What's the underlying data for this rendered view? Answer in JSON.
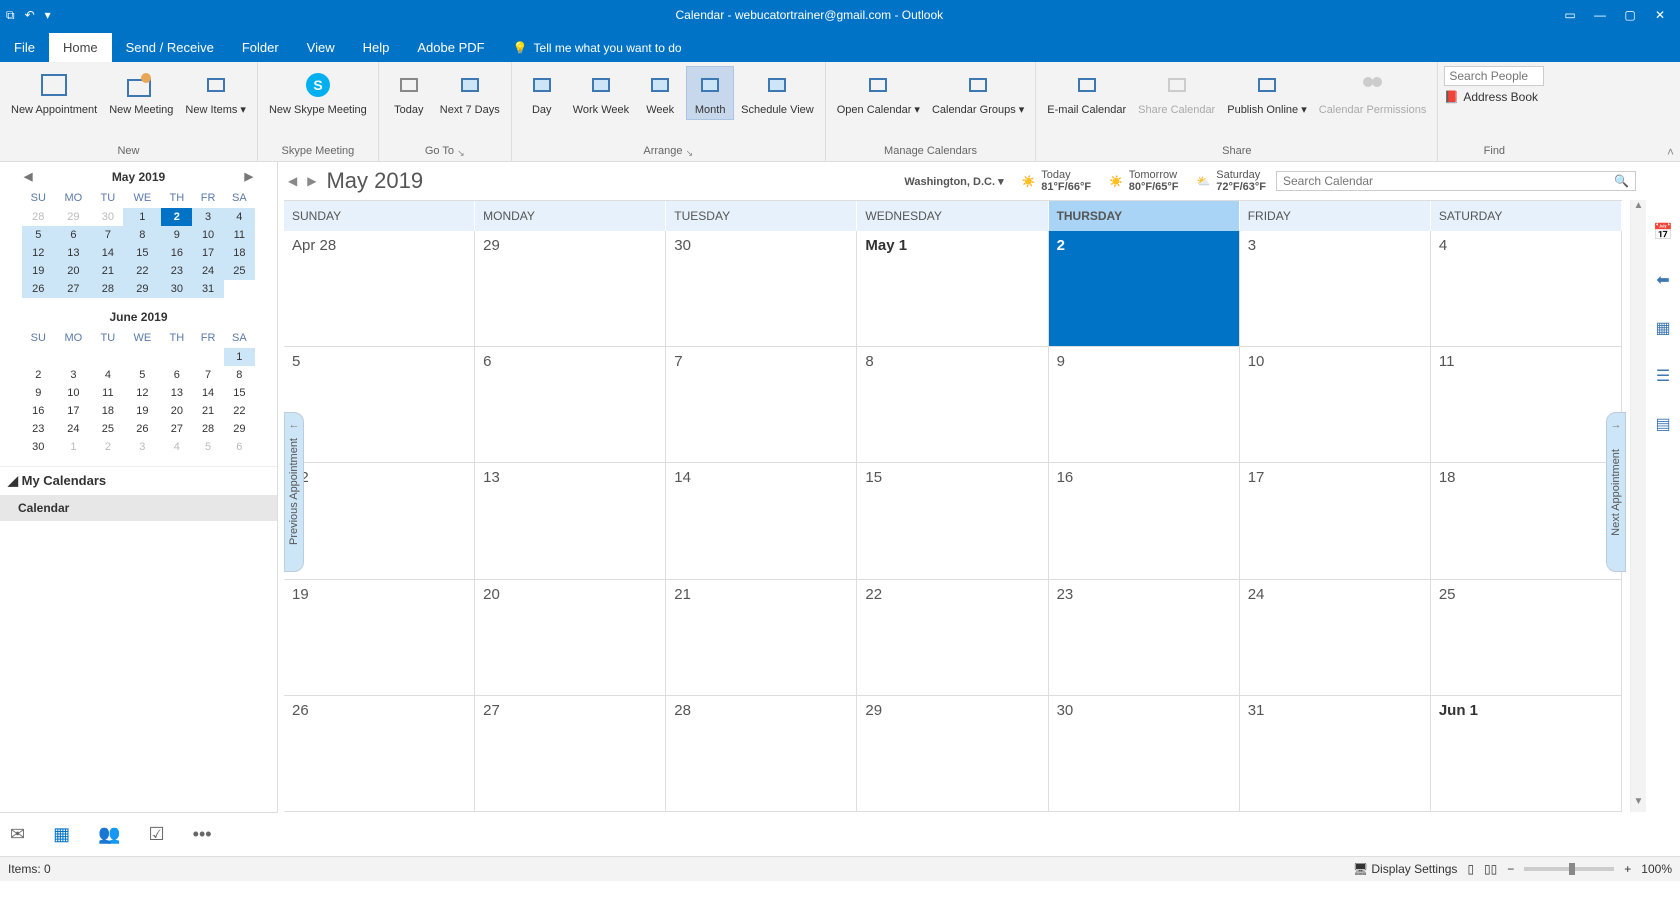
{
  "window": {
    "title": "Calendar - webucatortrainer@gmail.com - Outlook"
  },
  "tabs": [
    "File",
    "Home",
    "Send / Receive",
    "Folder",
    "View",
    "Help",
    "Adobe PDF"
  ],
  "active_tab": "Home",
  "tellme_placeholder": "Tell me what you want to do",
  "ribbon": {
    "new": {
      "appointment": "New Appointment",
      "meeting": "New Meeting",
      "items": "New Items ▾",
      "caption": "New"
    },
    "skype": {
      "meeting": "New Skype Meeting",
      "caption": "Skype Meeting"
    },
    "goto": {
      "today": "Today",
      "next7": "Next 7 Days",
      "caption": "Go To"
    },
    "arrange": {
      "day": "Day",
      "workweek": "Work Week",
      "week": "Week",
      "month": "Month",
      "schedule": "Schedule View",
      "caption": "Arrange"
    },
    "manage": {
      "open": "Open Calendar ▾",
      "groups": "Calendar Groups ▾",
      "caption": "Manage Calendars"
    },
    "share": {
      "email": "E-mail Calendar",
      "share": "Share Calendar",
      "publish": "Publish Online ▾",
      "perm": "Calendar Permissions",
      "caption": "Share"
    },
    "find": {
      "search_placeholder": "Search People",
      "address": "Address Book",
      "caption": "Find"
    }
  },
  "minical": [
    {
      "title": "May 2019",
      "weeks": [
        [
          {
            "d": "28",
            "o": true
          },
          {
            "d": "29",
            "o": true
          },
          {
            "d": "30",
            "o": true
          },
          {
            "d": "1",
            "hl": true
          },
          {
            "d": "2",
            "today": true
          },
          {
            "d": "3",
            "hl": true
          },
          {
            "d": "4",
            "hl": true
          }
        ],
        [
          {
            "d": "5",
            "hl": true
          },
          {
            "d": "6",
            "hl": true
          },
          {
            "d": "7",
            "hl": true
          },
          {
            "d": "8",
            "hl": true
          },
          {
            "d": "9",
            "hl": true
          },
          {
            "d": "10",
            "hl": true
          },
          {
            "d": "11",
            "hl": true
          }
        ],
        [
          {
            "d": "12",
            "hl": true
          },
          {
            "d": "13",
            "hl": true
          },
          {
            "d": "14",
            "hl": true
          },
          {
            "d": "15",
            "hl": true
          },
          {
            "d": "16",
            "hl": true
          },
          {
            "d": "17",
            "hl": true
          },
          {
            "d": "18",
            "hl": true
          }
        ],
        [
          {
            "d": "19",
            "hl": true
          },
          {
            "d": "20",
            "hl": true
          },
          {
            "d": "21",
            "hl": true
          },
          {
            "d": "22",
            "hl": true
          },
          {
            "d": "23",
            "hl": true
          },
          {
            "d": "24",
            "hl": true
          },
          {
            "d": "25",
            "hl": true
          }
        ],
        [
          {
            "d": "26",
            "hl": true
          },
          {
            "d": "27",
            "hl": true
          },
          {
            "d": "28",
            "hl": true
          },
          {
            "d": "29",
            "hl": true
          },
          {
            "d": "30",
            "hl": true
          },
          {
            "d": "31",
            "hl": true
          },
          {
            "d": "",
            "o": true
          }
        ]
      ]
    },
    {
      "title": "June 2019",
      "weeks": [
        [
          {
            "d": ""
          },
          {
            "d": ""
          },
          {
            "d": ""
          },
          {
            "d": ""
          },
          {
            "d": ""
          },
          {
            "d": ""
          },
          {
            "d": "1",
            "hl": true
          }
        ],
        [
          {
            "d": "2"
          },
          {
            "d": "3"
          },
          {
            "d": "4"
          },
          {
            "d": "5"
          },
          {
            "d": "6"
          },
          {
            "d": "7"
          },
          {
            "d": "8"
          }
        ],
        [
          {
            "d": "9"
          },
          {
            "d": "10"
          },
          {
            "d": "11"
          },
          {
            "d": "12"
          },
          {
            "d": "13"
          },
          {
            "d": "14"
          },
          {
            "d": "15"
          }
        ],
        [
          {
            "d": "16"
          },
          {
            "d": "17"
          },
          {
            "d": "18"
          },
          {
            "d": "19"
          },
          {
            "d": "20"
          },
          {
            "d": "21"
          },
          {
            "d": "22"
          }
        ],
        [
          {
            "d": "23"
          },
          {
            "d": "24"
          },
          {
            "d": "25"
          },
          {
            "d": "26"
          },
          {
            "d": "27"
          },
          {
            "d": "28"
          },
          {
            "d": "29"
          }
        ],
        [
          {
            "d": "30"
          },
          {
            "d": "1",
            "o": true
          },
          {
            "d": "2",
            "o": true
          },
          {
            "d": "3",
            "o": true
          },
          {
            "d": "4",
            "o": true
          },
          {
            "d": "5",
            "o": true
          },
          {
            "d": "6",
            "o": true
          }
        ]
      ]
    }
  ],
  "dow": [
    "SU",
    "MO",
    "TU",
    "WE",
    "TH",
    "FR",
    "SA"
  ],
  "my_calendars": {
    "header": "My Calendars",
    "item": "Calendar"
  },
  "content": {
    "title": "May 2019",
    "location": "Washington,  D.C. ▾",
    "weather": [
      {
        "lbl": "Today",
        "temp": "81°F/66°F"
      },
      {
        "lbl": "Tomorrow",
        "temp": "80°F/65°F"
      },
      {
        "lbl": "Saturday",
        "temp": "72°F/63°F"
      }
    ],
    "search_placeholder": "Search Calendar",
    "day_headers": [
      "SUNDAY",
      "MONDAY",
      "TUESDAY",
      "WEDNESDAY",
      "THURSDAY",
      "FRIDAY",
      "SATURDAY"
    ],
    "today_index": 4,
    "cells": [
      {
        "t": "Apr 28"
      },
      {
        "t": "29"
      },
      {
        "t": "30"
      },
      {
        "t": "May 1",
        "bold": true
      },
      {
        "t": "2",
        "today": true
      },
      {
        "t": "3"
      },
      {
        "t": "4"
      },
      {
        "t": "5"
      },
      {
        "t": "6"
      },
      {
        "t": "7"
      },
      {
        "t": "8"
      },
      {
        "t": "9"
      },
      {
        "t": "10"
      },
      {
        "t": "11"
      },
      {
        "t": "12"
      },
      {
        "t": "13"
      },
      {
        "t": "14"
      },
      {
        "t": "15"
      },
      {
        "t": "16"
      },
      {
        "t": "17"
      },
      {
        "t": "18"
      },
      {
        "t": "19"
      },
      {
        "t": "20"
      },
      {
        "t": "21"
      },
      {
        "t": "22"
      },
      {
        "t": "23"
      },
      {
        "t": "24"
      },
      {
        "t": "25"
      },
      {
        "t": "26"
      },
      {
        "t": "27"
      },
      {
        "t": "28"
      },
      {
        "t": "29"
      },
      {
        "t": "30"
      },
      {
        "t": "31"
      },
      {
        "t": "Jun 1",
        "bold": true
      }
    ],
    "prev_appt": "Previous Appointment",
    "next_appt": "Next Appointment"
  },
  "status": {
    "items": "Items: 0",
    "display": "Display Settings",
    "zoom": "100%"
  }
}
